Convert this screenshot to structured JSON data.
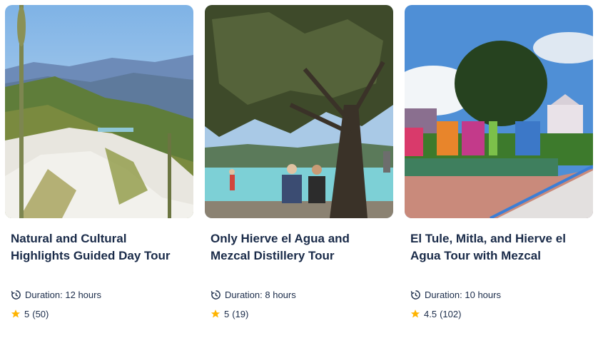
{
  "cards": [
    {
      "title": "Natural and Cultural Highlights Guided Day Tour",
      "duration_label": "Duration:",
      "duration_value": "12 hours",
      "rating": "5",
      "review_count": "(50)",
      "image_icon": "photo-petrified-waterfalls"
    },
    {
      "title": "Only Hierve el Agua and Mezcal Distillery Tour",
      "duration_label": "Duration:",
      "duration_value": "8 hours",
      "rating": "5",
      "review_count": "(19)",
      "image_icon": "photo-pool-under-tree"
    },
    {
      "title": "El Tule, Mitla, and Hierve el Agua Tour with Mezcal",
      "duration_label": "Duration:",
      "duration_value": "10 hours",
      "rating": "4.5",
      "review_count": "(102)",
      "image_icon": "photo-tule-sign-plaza"
    }
  ],
  "colors": {
    "text": "#1a2b49",
    "star": "#ffb400"
  }
}
